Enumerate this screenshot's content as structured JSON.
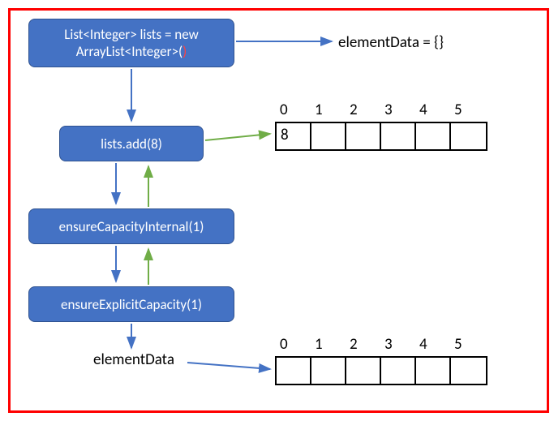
{
  "nodes": {
    "init": {
      "line1": "List<Integer> lists = new",
      "line2_prefix": "ArrayList<Integer>(",
      "line2_red": ")",
      "line2_suffix": ""
    },
    "add": "lists.add(8)",
    "ensureInternal": "ensureCapacityInternal(1)",
    "ensureExplicit": "ensureExplicitCapacity(1)"
  },
  "labels": {
    "elementDataInit": "elementData = {}",
    "elementDataFinal": "elementData"
  },
  "array1": {
    "indices": [
      "0",
      "1",
      "2",
      "3",
      "4",
      "5"
    ],
    "values": [
      "8",
      "",
      "",
      "",
      "",
      ""
    ]
  },
  "array2": {
    "indices": [
      "0",
      "1",
      "2",
      "3",
      "4",
      "5"
    ],
    "values": [
      "",
      "",
      "",
      "",
      "",
      ""
    ]
  },
  "chart_data": {
    "type": "table",
    "title": "ArrayList add(8) internal flow",
    "steps": [
      "List<Integer> lists = new ArrayList<Integer>()",
      "lists.add(8)",
      "ensureCapacityInternal(1)",
      "ensureExplicitCapacity(1)"
    ],
    "elementData_initial": [],
    "elementData_after_add": [
      8,
      null,
      null,
      null,
      null,
      null
    ],
    "elementData_final_shown": [
      null,
      null,
      null,
      null,
      null,
      null
    ]
  }
}
